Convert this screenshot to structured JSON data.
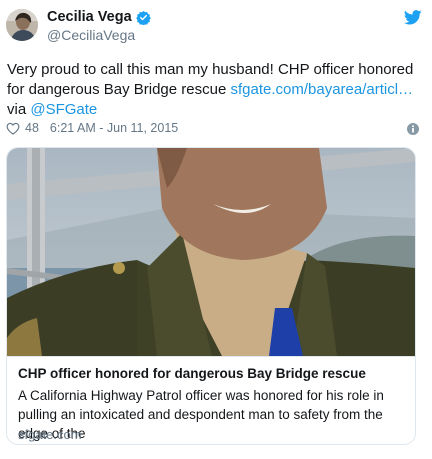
{
  "user": {
    "display_name": "Cecilia Vega",
    "handle": "@CeciliaVega",
    "verified_icon": "verified-badge-icon",
    "avatar_icon": "user-avatar"
  },
  "tweet": {
    "text_prefix": "Very proud to call this man my husband! CHP officer honored for dangerous Bay Bridge rescue ",
    "link_text": "sfgate.com/bayarea/articl…",
    "via_text": " via ",
    "mention": "@SFGate",
    "likes": "48",
    "timestamp": "6:21 AM - Jun 11, 2015"
  },
  "card": {
    "title": "CHP officer honored for dangerous Bay Bridge rescue",
    "description": "A California Highway Patrol officer was honored for his role in pulling an intoxicated and despondent man to safety from the edge of the",
    "domain": "sfgate.com"
  },
  "colors": {
    "link": "#1b95e0",
    "secondary_text": "#657786",
    "primary_text": "#14171a",
    "border": "#e1e8ed"
  }
}
